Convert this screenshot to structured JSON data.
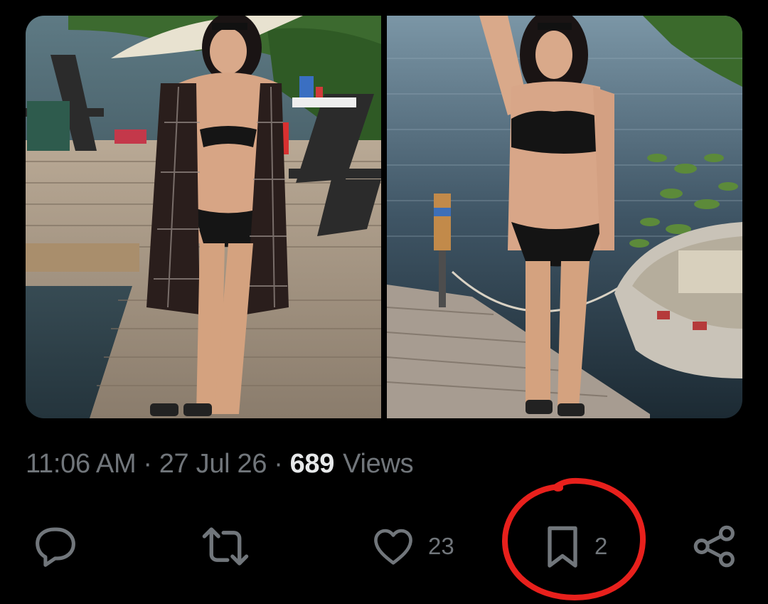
{
  "media": {
    "images": [
      {
        "name": "photo-dock-lounge",
        "alt": "Photo on a wooden dock with chairs and umbrella"
      },
      {
        "name": "photo-dock-lake",
        "alt": "Photo on a dock by the lake with a rowboat"
      }
    ]
  },
  "meta": {
    "time": "11:06 AM",
    "separator": "·",
    "date": "27 Jul 26",
    "views_count": "689",
    "views_label": "Views"
  },
  "actions": {
    "reply": {
      "icon": "reply-icon",
      "count": ""
    },
    "repost": {
      "icon": "repost-icon",
      "count": ""
    },
    "like": {
      "icon": "heart-icon",
      "count": "23"
    },
    "bookmark": {
      "icon": "bookmark-icon",
      "count": "2"
    },
    "share": {
      "icon": "share-icon",
      "count": ""
    }
  },
  "colors": {
    "background": "#000000",
    "secondary_text": "#71767b",
    "primary_text": "#e7e9ea",
    "annotation": "#e8201c"
  }
}
